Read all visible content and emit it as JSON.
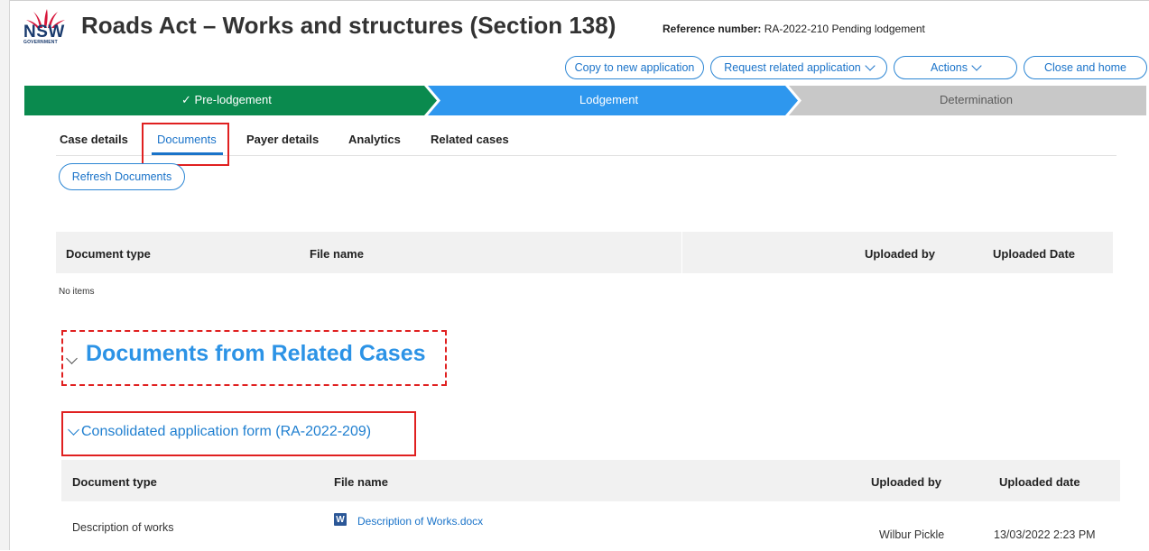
{
  "header": {
    "logo_text": "NSW",
    "logo_subtext": "GOVERNMENT",
    "title": "Roads Act – Works and structures (Section 138)",
    "reference_label": "Reference number:",
    "reference_value": "RA-2022-210",
    "status": "Pending lodgement"
  },
  "actions": {
    "copy": "Copy to new application",
    "request": "Request related application",
    "actions": "Actions",
    "close": "Close and home"
  },
  "stages": [
    {
      "label": "Pre-lodgement",
      "state": "complete",
      "color": "#0a8a4e"
    },
    {
      "label": "Lodgement",
      "state": "current",
      "color": "#2e97ee"
    },
    {
      "label": "Determination",
      "state": "upcoming",
      "color": "#c8c8c8"
    }
  ],
  "tabs": [
    "Case details",
    "Documents",
    "Payer details",
    "Analytics",
    "Related cases"
  ],
  "active_tab": "Documents",
  "refresh_button": "Refresh Documents",
  "documents_table": {
    "columns": [
      "Document type",
      "File name",
      "",
      "Uploaded by",
      "Uploaded Date"
    ],
    "empty_text": "No items"
  },
  "related": {
    "title": "Documents from Related Cases",
    "group_title": "Consolidated application form (RA-2022-209)",
    "columns": [
      "Document type",
      "File name",
      "Uploaded by",
      "Uploaded date"
    ],
    "rows": [
      {
        "type": "Description of works",
        "file": "Description of Works.docx",
        "icon": "word-doc-icon",
        "uploaded_by": "Wilbur Pickle",
        "date": "13/03/2022 2:23 PM"
      }
    ]
  },
  "colors": {
    "accent": "#1a73c9",
    "highlight": "#e02020"
  }
}
